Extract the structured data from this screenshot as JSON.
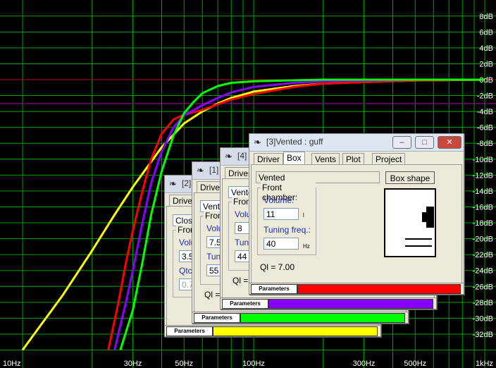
{
  "chart_data": {
    "type": "line",
    "x_axis": {
      "scale": "log",
      "range_hz": [
        10,
        1000
      ],
      "tick_labels": [
        {
          "hz": 10,
          "label": "10Hz"
        },
        {
          "hz": 30,
          "label": "30Hz"
        },
        {
          "hz": 50,
          "label": "50Hz"
        },
        {
          "hz": 100,
          "label": "100Hz"
        },
        {
          "hz": 300,
          "label": "300Hz"
        },
        {
          "hz": 500,
          "label": "500Hz"
        },
        {
          "hz": 1000,
          "label": "1kHz"
        }
      ]
    },
    "y_axis": {
      "range_db": [
        -34,
        9
      ],
      "tick_labels": [
        {
          "db": 8,
          "label": "8dB"
        },
        {
          "db": 6,
          "label": "6dB"
        },
        {
          "db": 4,
          "label": "4dB"
        },
        {
          "db": 2,
          "label": "2dB"
        },
        {
          "db": 0,
          "label": "0dB"
        },
        {
          "db": -2,
          "label": "-2dB"
        },
        {
          "db": -4,
          "label": "-4dB"
        },
        {
          "db": -6,
          "label": "-6dB"
        },
        {
          "db": -8,
          "label": "-8dB"
        },
        {
          "db": -10,
          "label": "-10dB"
        },
        {
          "db": -12,
          "label": "-12dB"
        },
        {
          "db": -14,
          "label": "-14dB"
        },
        {
          "db": -16,
          "label": "-16dB"
        },
        {
          "db": -18,
          "label": "-18dB"
        },
        {
          "db": -20,
          "label": "-20dB"
        },
        {
          "db": -22,
          "label": "-22dB"
        },
        {
          "db": -24,
          "label": "-24dB"
        },
        {
          "db": -26,
          "label": "-26dB"
        },
        {
          "db": -28,
          "label": "-28dB"
        },
        {
          "db": -30,
          "label": "-30dB"
        },
        {
          "db": -32,
          "label": "-32dB"
        }
      ]
    },
    "grid": true,
    "reference_lines_db": [
      {
        "db": 0,
        "color": "#cc0033"
      },
      {
        "db": -3,
        "color": "#aa00aa"
      }
    ],
    "series": [
      {
        "color": "#ffff00",
        "points": [
          [
            10,
            -34
          ],
          [
            15,
            -27
          ],
          [
            20,
            -21.5
          ],
          [
            25,
            -17
          ],
          [
            30,
            -13.5
          ],
          [
            40,
            -8.5
          ],
          [
            50,
            -5.5
          ],
          [
            60,
            -4
          ],
          [
            70,
            -3
          ],
          [
            80,
            -2.3
          ],
          [
            100,
            -1.5
          ],
          [
            150,
            -0.8
          ],
          [
            200,
            -0.5
          ],
          [
            300,
            -0.3
          ],
          [
            500,
            -0.1
          ],
          [
            1000,
            0
          ]
        ]
      },
      {
        "color": "#ff0000",
        "points": [
          [
            23.5,
            -34
          ],
          [
            26,
            -28
          ],
          [
            28,
            -23
          ],
          [
            30,
            -19
          ],
          [
            33,
            -14
          ],
          [
            36,
            -10
          ],
          [
            40,
            -6.8
          ],
          [
            45,
            -5
          ],
          [
            50,
            -4.4
          ],
          [
            60,
            -3.8
          ],
          [
            70,
            -3.1
          ],
          [
            80,
            -2.5
          ],
          [
            100,
            -1.8
          ],
          [
            150,
            -0.9
          ],
          [
            200,
            -0.5
          ],
          [
            300,
            -0.3
          ],
          [
            500,
            -0.1
          ],
          [
            1000,
            0
          ]
        ]
      },
      {
        "color": "#8800ff",
        "points": [
          [
            25,
            -34
          ],
          [
            28,
            -28
          ],
          [
            30,
            -24
          ],
          [
            33,
            -18
          ],
          [
            36,
            -13
          ],
          [
            40,
            -9
          ],
          [
            45,
            -6
          ],
          [
            50,
            -4.5
          ],
          [
            60,
            -3.2
          ],
          [
            70,
            -2.3
          ],
          [
            80,
            -1.6
          ],
          [
            100,
            -0.9
          ],
          [
            150,
            -0.4
          ],
          [
            200,
            -0.2
          ],
          [
            500,
            0
          ],
          [
            1000,
            0
          ]
        ]
      },
      {
        "color": "#00ff00",
        "points": [
          [
            26.5,
            -34
          ],
          [
            30,
            -29
          ],
          [
            33,
            -23
          ],
          [
            36,
            -17
          ],
          [
            40,
            -11.5
          ],
          [
            45,
            -7
          ],
          [
            50,
            -4.2
          ],
          [
            55,
            -2.8
          ],
          [
            60,
            -1.7
          ],
          [
            70,
            -0.8
          ],
          [
            80,
            -0.4
          ],
          [
            100,
            -0.2
          ],
          [
            200,
            0
          ],
          [
            1000,
            0
          ]
        ]
      }
    ]
  },
  "windows": {
    "w2": {
      "title": "[2]",
      "tab": "Driver",
      "dropdown": "Close",
      "group": "Fron",
      "vol_label": "Volu",
      "vol_value": "3.5",
      "qtc_label": "Qtc:",
      "qtc_value": "0.7",
      "params": "Parameters",
      "color": "#ffff00"
    },
    "w1": {
      "title": "[1]",
      "tab": "Driver",
      "dropdown": "Vente",
      "group": "Fron",
      "vol_label": "Volu",
      "vol_value": "7.5",
      "tune_label": "Tuni",
      "tune_value": "55",
      "ql": "Ql = 7",
      "params": "Parameters",
      "color": "#00ff00"
    },
    "w4": {
      "title": "[4]",
      "tab": "Driver",
      "dropdown": "Vente",
      "group": "Fron",
      "vol_label": "Volu",
      "vol_value": "8",
      "tune_label": "Tuni",
      "tune_value": "44",
      "ql": "Ql = 7",
      "params": "Parameters",
      "color": "#8800ff"
    },
    "w3": {
      "title": "[3]Vented : guff",
      "tabs": [
        "Driver",
        "Box",
        "Vents",
        "Plot",
        "Project"
      ],
      "active_tab": "Box",
      "box_type": "Vented",
      "box_shape_btn": "Box shape",
      "group": "Front chamber:",
      "vol_label": "Volume:",
      "vol_value": "11",
      "vol_unit": "l",
      "tune_label": "Tuning freq.:",
      "tune_value": "40",
      "tune_unit": "Hz",
      "ql": "Ql = 7.00",
      "params": "Parameters",
      "color": "#ff0000"
    }
  }
}
